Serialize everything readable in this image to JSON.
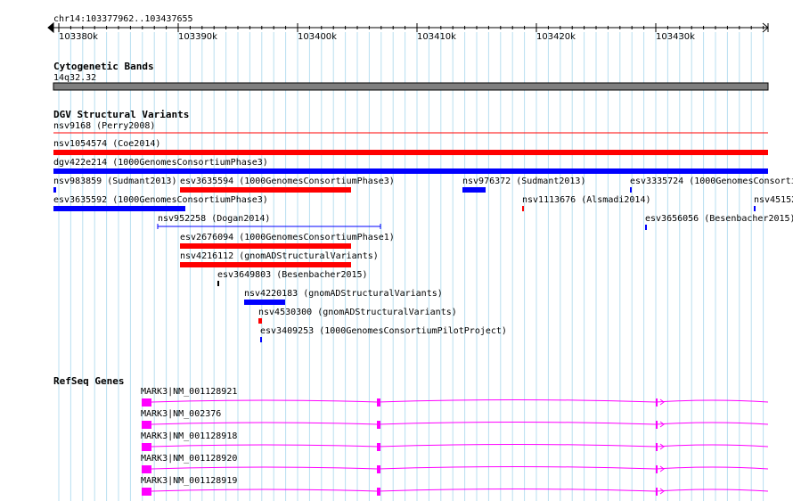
{
  "ruler": {
    "locus": "chr14:103377962..103437655",
    "ticks": [
      "103380k",
      "103390k",
      "103400k",
      "103410k",
      "103420k",
      "103430k"
    ]
  },
  "cytoband": {
    "title": "Cytogenetic Bands",
    "band": "14q32.32"
  },
  "dgv": {
    "title": "DGV Structural Variants",
    "features": [
      {
        "label": "nsv9168 (Perry2008)",
        "color": "#ff0000",
        "style": "line"
      },
      {
        "label": "nsv1054574 (Coe2014)",
        "color": "#ff0000",
        "style": "bar"
      },
      {
        "label": "dgv422e214 (1000GenomesConsortiumPhase3)",
        "color": "#0000ff",
        "style": "bar"
      },
      {
        "label": "nsv983859 (Sudmant2013)",
        "color": "#0000ff",
        "style": "bar"
      },
      {
        "label": "esv3635594 (1000GenomesConsortiumPhase3)",
        "color": "#ff0000",
        "style": "bar"
      },
      {
        "label": "nsv976372 (Sudmant2013)",
        "color": "#0000ff",
        "style": "bar"
      },
      {
        "label": "esv3335724 (1000GenomesConsorti",
        "color": "#0000ff",
        "style": "bar"
      },
      {
        "label": "esv3635592 (1000GenomesConsortiumPhase3)",
        "color": "#0000ff",
        "style": "bar"
      },
      {
        "label": "nsv1113676 (Alsmadi2014)",
        "color": "#ff0000",
        "style": "bar"
      },
      {
        "label": "nsv45152",
        "color": "#0000ff",
        "style": "bar"
      },
      {
        "label": "nsv952258 (Dogan2014)",
        "color": "#0000ff",
        "style": "line"
      },
      {
        "label": "esv3656056 (Besenbacher2015)",
        "color": "#0000ff",
        "style": "bar"
      },
      {
        "label": "esv2676094 (1000GenomesConsortiumPhase1)",
        "color": "#ff0000",
        "style": "bar"
      },
      {
        "label": "nsv4216112 (gnomADStructuralVariants)",
        "color": "#ff0000",
        "style": "bar"
      },
      {
        "label": "esv3649803 (Besenbacher2015)",
        "color": "#000000",
        "style": "bar"
      },
      {
        "label": "nsv4220183 (gnomADStructuralVariants)",
        "color": "#0000ff",
        "style": "bar"
      },
      {
        "label": "nsv4530300 (gnomADStructuralVariants)",
        "color": "#ff0000",
        "style": "bar"
      },
      {
        "label": "esv3409253 (1000GenomesConsortiumPilotProject)",
        "color": "#0000ff",
        "style": "bar"
      }
    ]
  },
  "refseq": {
    "title": "RefSeq Genes",
    "genes": [
      {
        "label": "MARK3|NM_001128921"
      },
      {
        "label": "MARK3|NM_002376"
      },
      {
        "label": "MARK3|NM_001128918"
      },
      {
        "label": "MARK3|NM_001128920"
      },
      {
        "label": "MARK3|NM_001128919"
      }
    ],
    "color": "#ff00ff"
  },
  "colors": {
    "gridline": "#b8dff0",
    "cytoband": "#7f7f7f",
    "variant_loss": "#ff0000",
    "variant_gain": "#0000ff"
  }
}
